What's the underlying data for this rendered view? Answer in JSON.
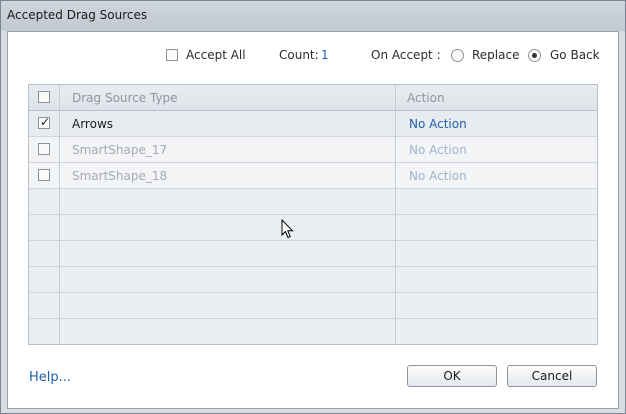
{
  "window": {
    "title": "Accepted Drag Sources"
  },
  "toolbar": {
    "accept_all_label": "Accept All",
    "accept_all_checked": false,
    "count_label": "Count:",
    "count_value": "1",
    "on_accept_label": "On Accept :",
    "options": [
      {
        "label": "Replace",
        "selected": false
      },
      {
        "label": "Go Back",
        "selected": true
      }
    ]
  },
  "grid": {
    "headers": {
      "type": "Drag Source Type",
      "action": "Action"
    },
    "rows": [
      {
        "type": "Arrows",
        "action": "No Action",
        "checked": true
      },
      {
        "type": "SmartShape_17",
        "action": "No Action",
        "checked": false
      },
      {
        "type": "SmartShape_18",
        "action": "No Action",
        "checked": false
      }
    ]
  },
  "footer": {
    "help_label": "Help...",
    "ok_label": "OK",
    "cancel_label": "Cancel"
  },
  "colors": {
    "accent": "#1f5fa8",
    "disabled_text": "#a6abb1",
    "disabled_link": "#9fb4cf"
  }
}
